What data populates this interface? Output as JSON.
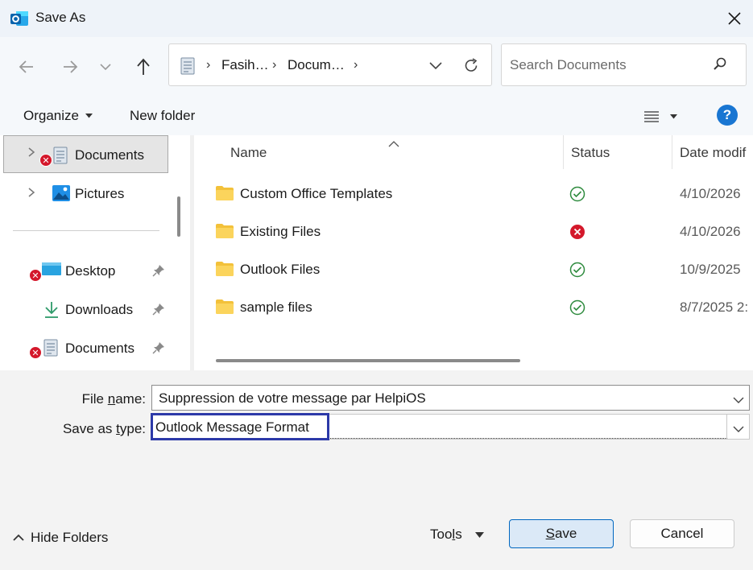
{
  "window": {
    "title": "Save As",
    "accent_color": "#0067c0"
  },
  "navigation": {
    "breadcrumbs": [
      "Fasih…",
      "Docum…"
    ],
    "search_placeholder": "Search Documents"
  },
  "toolbar": {
    "organize_label": "Organize",
    "new_folder_label": "New folder",
    "help_label": "?"
  },
  "sidebar": {
    "top_items": [
      {
        "label": "Documents",
        "status": "error",
        "selected": true,
        "icon": "documents-icon"
      },
      {
        "label": "Pictures",
        "icon": "pictures-icon"
      }
    ],
    "quick_access": [
      {
        "label": "Desktop",
        "status": "error",
        "pinned": true,
        "icon": "desktop-icon"
      },
      {
        "label": "Downloads",
        "pinned": true,
        "icon": "downloads-icon"
      },
      {
        "label": "Documents",
        "status": "error",
        "pinned": true,
        "icon": "documents-icon"
      }
    ]
  },
  "file_list": {
    "columns": [
      "Name",
      "Status",
      "Date modif"
    ],
    "rows": [
      {
        "name": "Custom Office Templates",
        "status": "synced",
        "date": "4/10/2026"
      },
      {
        "name": "Existing Files",
        "status": "error",
        "date": "4/10/2026"
      },
      {
        "name": "Outlook Files",
        "status": "synced",
        "date": "10/9/2025"
      },
      {
        "name": "sample files",
        "status": "synced",
        "date": "8/7/2025 2:"
      }
    ]
  },
  "form": {
    "file_name_label_pre": "File ",
    "file_name_label_u": "n",
    "file_name_label_post": "ame:",
    "file_name_value": "Suppression de votre message par HelpiOS",
    "save_type_label_pre": "Save as ",
    "save_type_label_u": "t",
    "save_type_label_post": "ype:",
    "save_type_value": "Outlook Message Format"
  },
  "footer": {
    "hide_folders_label": "Hide Folders",
    "tools_label_pre": "Too",
    "tools_label_u": "l",
    "tools_label_post": "s",
    "save_label_u": "S",
    "save_label_post": "ave",
    "cancel_label": "Cancel"
  },
  "colors": {
    "error": "#d4182b",
    "synced": "#2e8b3e",
    "folder": "#f3c13a",
    "focus_border": "#2c39a8"
  }
}
